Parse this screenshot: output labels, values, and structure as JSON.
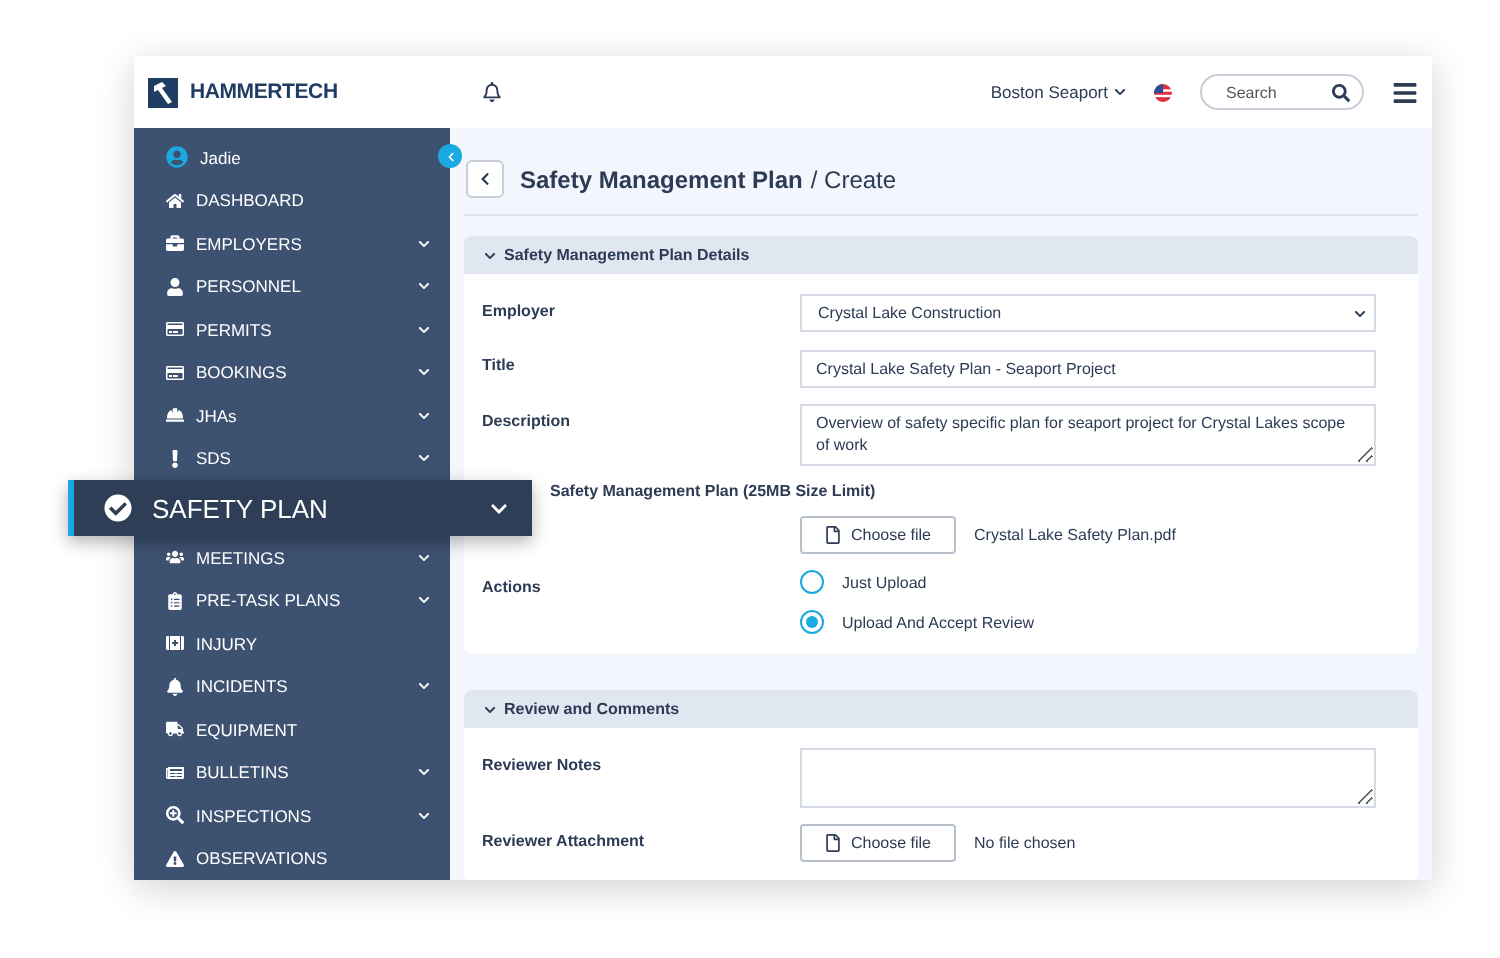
{
  "topbar": {
    "logo": "HAMMERTECH",
    "project": "Boston Seaport",
    "search": {
      "placeholder": "Search"
    }
  },
  "sidebar": {
    "user": "Jadie",
    "items": [
      {
        "label": "DASHBOARD",
        "expandable": false,
        "selected": false
      },
      {
        "label": "EMPLOYERS",
        "expandable": true,
        "selected": false
      },
      {
        "label": "PERSONNEL",
        "expandable": true,
        "selected": false
      },
      {
        "label": "PERMITS",
        "expandable": true,
        "selected": false
      },
      {
        "label": "BOOKINGS",
        "expandable": true,
        "selected": false
      },
      {
        "label": "JHAs",
        "expandable": true,
        "selected": false
      },
      {
        "label": "SDS",
        "expandable": true,
        "selected": false
      },
      {
        "label": "SAFETY PLAN",
        "expandable": true,
        "selected": true
      },
      {
        "label": "MEETINGS",
        "expandable": true,
        "selected": false
      },
      {
        "label": "PRE-TASK PLANS",
        "expandable": true,
        "selected": false
      },
      {
        "label": "INJURY",
        "expandable": false,
        "selected": false
      },
      {
        "label": "INCIDENTS",
        "expandable": true,
        "selected": false
      },
      {
        "label": "EQUIPMENT",
        "expandable": false,
        "selected": false
      },
      {
        "label": "BULLETINS",
        "expandable": true,
        "selected": false
      },
      {
        "label": "INSPECTIONS",
        "expandable": true,
        "selected": false
      },
      {
        "label": "OBSERVATIONS",
        "expandable": false,
        "selected": false
      }
    ]
  },
  "page": {
    "title": "Safety Management Plan",
    "subtitle": "/ Create"
  },
  "sections": [
    {
      "title": "Safety Management Plan Details",
      "fields": [
        {
          "kind": "select",
          "label": "Employer",
          "value": "Crystal Lake Construction"
        },
        {
          "kind": "text",
          "label": "Title",
          "value": "Crystal Lake Safety Plan - Seaport Project"
        },
        {
          "kind": "textarea",
          "label": "Description",
          "value": "Overview of safety specific plan for seaport project for Crystal Lakes scope of work"
        },
        {
          "kind": "file",
          "label": "Safety Management Plan (25MB Size Limit)",
          "button": "Choose file",
          "file": "Crystal Lake Safety Plan.pdf"
        },
        {
          "kind": "radio",
          "label": "Actions",
          "options": [
            {
              "label": "Just Upload",
              "selected": false
            },
            {
              "label": "Upload And Accept Review",
              "selected": true
            }
          ]
        }
      ]
    },
    {
      "title": "Review and Comments",
      "fields": [
        {
          "kind": "textarea",
          "label": "Reviewer Notes"
        },
        {
          "kind": "inline-file",
          "label": "Reviewer Attachment",
          "button": "Choose file",
          "file": "No file chosen"
        }
      ]
    }
  ]
}
